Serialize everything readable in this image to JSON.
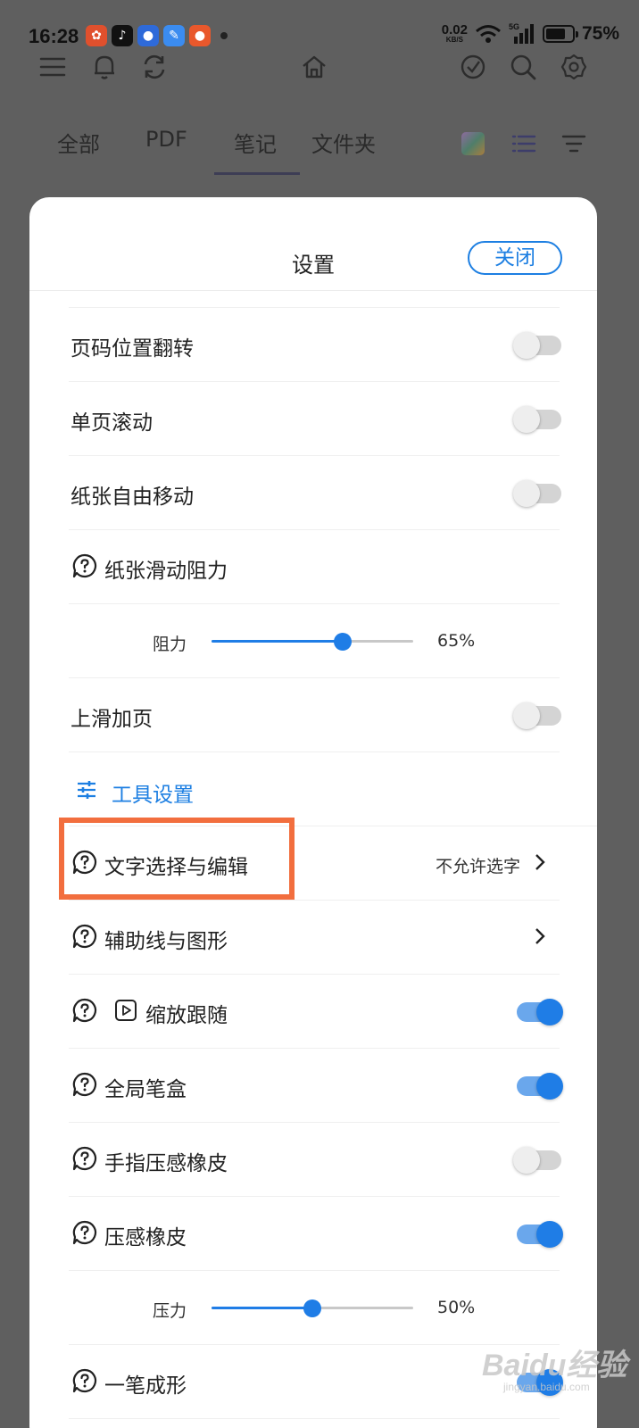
{
  "status_bar": {
    "time": "16:28",
    "net_speed": "0.02",
    "net_unit": "KB/S",
    "signal_label": "5G",
    "battery_percent": "75%",
    "battery_level": 0.75
  },
  "tabs": {
    "all": "全部",
    "pdf": "PDF",
    "notes": "笔记",
    "folders": "文件夹",
    "active": "notes"
  },
  "modal": {
    "title": "设置",
    "close_label": "关闭",
    "rows": {
      "page_number_flip": {
        "label": "页码位置翻转",
        "on": false
      },
      "single_page_scroll": {
        "label": "单页滚动",
        "on": false
      },
      "paper_free_move": {
        "label": "纸张自由移动",
        "on": false
      },
      "paper_slide_resistance": {
        "label": "纸张滑动阻力"
      },
      "resistance_slider": {
        "label": "阻力",
        "value_text": "65%",
        "value": 0.65
      },
      "swipe_up_add_page": {
        "label": "上滑加页",
        "on": false
      },
      "tool_settings": {
        "label": "工具设置"
      },
      "text_select_edit": {
        "label": "文字选择与编辑",
        "value": "不允许选字"
      },
      "guides_shapes": {
        "label": "辅助线与图形"
      },
      "zoom_follow": {
        "label": "缩放跟随",
        "on": true
      },
      "global_pen_box": {
        "label": "全局笔盒",
        "on": true
      },
      "finger_pressure_eraser": {
        "label": "手指压感橡皮",
        "on": false
      },
      "pressure_eraser": {
        "label": "压感橡皮",
        "on": true
      },
      "pressure_slider": {
        "label": "压力",
        "value_text": "50%",
        "value": 0.5
      },
      "one_stroke_shape": {
        "label": "一笔成形",
        "on": true
      }
    }
  },
  "watermark": {
    "brand": "Baidu经验",
    "url": "jingyan.baidu.com"
  },
  "colors": {
    "accent": "#1d7fe2",
    "highlight_box": "#f26e3e",
    "toggle_on": "#1f7de6",
    "toggle_off": "#d4d4d4"
  }
}
